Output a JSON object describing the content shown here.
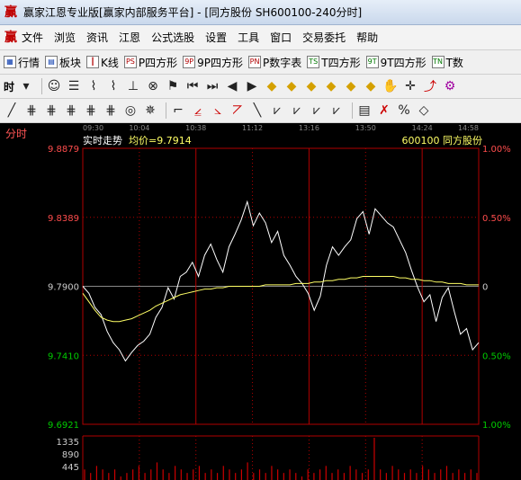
{
  "window": {
    "title": "赢家江恩专业版[赢家内部服务平台] - [同方股份  SH600100-240分时]",
    "icon_glyph": "赢"
  },
  "menu": [
    "文件",
    "浏览",
    "资讯",
    "江恩",
    "公式选股",
    "设置",
    "工具",
    "窗口",
    "交易委托",
    "帮助"
  ],
  "toolbar1": [
    {
      "icon": "grid-icon",
      "glyph": "▦",
      "label": "行情"
    },
    {
      "icon": "blocks-icon",
      "glyph": "▤",
      "label": "板块"
    },
    {
      "icon": "kline-icon",
      "glyph": "┃",
      "label": "K线"
    },
    {
      "icon": "ps-icon",
      "glyph": "PS",
      "label": "P四方形"
    },
    {
      "icon": "9p-icon",
      "glyph": "9P",
      "label": "9P四方形"
    },
    {
      "icon": "pn-icon",
      "glyph": "PN",
      "label": "P数字表"
    },
    {
      "icon": "ts-icon",
      "glyph": "TS",
      "label": "T四方形"
    },
    {
      "icon": "9t-icon",
      "glyph": "9T",
      "label": "9T四方形"
    },
    {
      "icon": "tn-icon",
      "glyph": "TN",
      "label": "T数"
    }
  ],
  "toolbar2": {
    "period_label": "时",
    "tools": [
      "☺",
      "☰",
      "⌇",
      "⌇",
      "⊥",
      "⊗",
      "⚑",
      "⏮",
      "⏭",
      "◀",
      "▶",
      "◆",
      "◆",
      "◆",
      "◆",
      "◆",
      "◆",
      "✋",
      "✛",
      "⤴",
      "⚙",
      "⬡"
    ]
  },
  "toolbar3": {
    "tools": [
      "╱",
      "⋕",
      "⋕",
      "⋕",
      "⋕",
      "⋕",
      "◎",
      "✵",
      "⌐",
      "⦤",
      "⦣",
      "⦢",
      "╲",
      "⩗",
      "⩗",
      "⩗",
      "⩗",
      "▤",
      "✗",
      "%",
      "◇"
    ]
  },
  "chart": {
    "sidebar_label": "分时",
    "panel_title": "实时走势",
    "avg_label": "均价=9.7914",
    "stock_info": "600100  同方股份",
    "time_labels": [
      "09:30",
      "10:04",
      "10:38",
      "11:12",
      "13:16",
      "13:50",
      "14:24",
      "14:58"
    ],
    "price_labels": [
      "9.8879",
      "9.8389",
      "9.7900",
      "9.7410",
      "9.6921"
    ],
    "pct_labels": [
      "1.00%",
      "0.50%",
      "0",
      "0.50%",
      "1.00%"
    ],
    "volume_labels": [
      "1335",
      "890",
      "445"
    ],
    "colors": {
      "up": "#ff4d4d",
      "down": "#00cc00",
      "neutral": "#cccccc",
      "grid": "#b00000",
      "price_line": "#ffffff",
      "avg_line": "#ffff66",
      "volume": "#cc0000"
    }
  },
  "chart_data": {
    "type": "line",
    "title": "实时走势",
    "ylim": [
      9.6921,
      9.8879
    ],
    "reference_price": 9.79,
    "series": [
      {
        "name": "价格",
        "values": [
          9.79,
          9.785,
          9.775,
          9.77,
          9.758,
          9.75,
          9.745,
          9.737,
          9.743,
          9.748,
          9.751,
          9.756,
          9.768,
          9.775,
          9.789,
          9.781,
          9.797,
          9.8,
          9.807,
          9.797,
          9.812,
          9.82,
          9.809,
          9.8,
          9.818,
          9.827,
          9.837,
          9.85,
          9.833,
          9.842,
          9.835,
          9.821,
          9.829,
          9.812,
          9.805,
          9.797,
          9.792,
          9.785,
          9.773,
          9.783,
          9.805,
          9.818,
          9.812,
          9.818,
          9.823,
          9.838,
          9.843,
          9.827,
          9.845,
          9.84,
          9.835,
          9.832,
          9.823,
          9.814,
          9.801,
          9.789,
          9.779,
          9.784,
          9.765,
          9.782,
          9.789,
          9.772,
          9.756,
          9.76,
          9.745,
          9.75
        ]
      },
      {
        "name": "均价",
        "values": [
          9.785,
          9.779,
          9.773,
          9.768,
          9.766,
          9.765,
          9.765,
          9.766,
          9.767,
          9.769,
          9.771,
          9.773,
          9.776,
          9.778,
          9.78,
          9.782,
          9.784,
          9.785,
          9.786,
          9.787,
          9.788,
          9.788,
          9.789,
          9.789,
          9.79,
          9.79,
          9.79,
          9.79,
          9.79,
          9.79,
          9.791,
          9.791,
          9.791,
          9.791,
          9.791,
          9.792,
          9.792,
          9.792,
          9.793,
          9.793,
          9.794,
          9.794,
          9.795,
          9.795,
          9.796,
          9.796,
          9.797,
          9.797,
          9.797,
          9.797,
          9.797,
          9.797,
          9.796,
          9.796,
          9.795,
          9.795,
          9.794,
          9.794,
          9.793,
          9.793,
          9.792,
          9.792,
          9.792,
          9.791,
          9.791,
          9.791
        ]
      }
    ],
    "volume": [
      3,
      2,
      4,
      3,
      2,
      3,
      1,
      2,
      3,
      4,
      2,
      3,
      5,
      3,
      2,
      4,
      3,
      2,
      3,
      4,
      2,
      3,
      2,
      4,
      3,
      2,
      3,
      5,
      2,
      3,
      2,
      4,
      3,
      2,
      3,
      2,
      1,
      3,
      2,
      3,
      4,
      2,
      3,
      2,
      4,
      3,
      2,
      3,
      12,
      3,
      2,
      4,
      3,
      2,
      3,
      2,
      4,
      3,
      2,
      3,
      4,
      2,
      3,
      2,
      3,
      2
    ]
  }
}
